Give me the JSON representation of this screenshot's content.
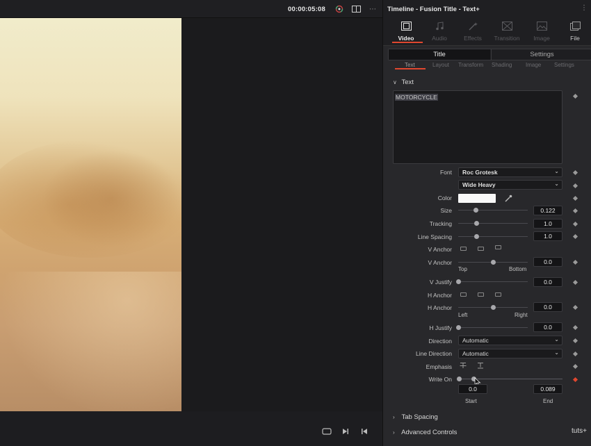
{
  "viewer": {
    "timecode": "00:00:05:08"
  },
  "inspector": {
    "title": "Timeline - Fusion Title - Text+",
    "tabs": [
      {
        "label": "Video",
        "icon": "film-icon",
        "state": "active"
      },
      {
        "label": "Audio",
        "icon": "music-note-icon",
        "state": "dim"
      },
      {
        "label": "Effects",
        "icon": "magic-wand-icon",
        "state": "dim"
      },
      {
        "label": "Transition",
        "icon": "transition-icon",
        "state": "dim"
      },
      {
        "label": "Image",
        "icon": "image-icon",
        "state": "dim"
      },
      {
        "label": "File",
        "icon": "file-icon",
        "state": "normal"
      }
    ],
    "segments": {
      "title": "Title",
      "settings": "Settings"
    },
    "subtabs": [
      "Text",
      "Layout",
      "Transform",
      "Shading",
      "Image",
      "Settings"
    ],
    "text_section": {
      "header": "Text",
      "content": "MOTORCYCLE",
      "font_label": "Font",
      "font_value": "Roc Grotesk",
      "style_value": "Wide Heavy",
      "color_label": "Color",
      "color_value": "#f8f8f8",
      "size_label": "Size",
      "size_value": "0.122",
      "size_level": 0.25,
      "tracking_label": "Tracking",
      "tracking_value": "1.0",
      "tracking_level": 0.26,
      "line_spacing_label": "Line Spacing",
      "line_spacing_value": "1.0",
      "line_spacing_level": 0.26,
      "v_anchor_label": "V Anchor",
      "v_anchor_value": "0.0",
      "v_anchor_level": 0.5,
      "v_anchor_left": "Top",
      "v_anchor_right": "Bottom",
      "v_justify_label": "V Justify",
      "v_justify_value": "0.0",
      "v_justify_level": 0.0,
      "h_anchor_label": "H Anchor",
      "h_anchor_value": "0.0",
      "h_anchor_level": 0.5,
      "h_anchor_left": "Left",
      "h_anchor_right": "Right",
      "h_justify_label": "H Justify",
      "h_justify_value": "0.0",
      "h_justify_level": 0.0,
      "direction_label": "Direction",
      "direction_value": "Automatic",
      "line_direction_label": "Line Direction",
      "line_direction_value": "Automatic",
      "emphasis_label": "Emphasis",
      "write_on_label": "Write On",
      "write_on_start_value": "0.0",
      "write_on_end_value": "0.089",
      "write_on_start_label": "Start",
      "write_on_end_label": "End"
    },
    "collapsed_sections": [
      "Tab Spacing",
      "Advanced Controls"
    ]
  },
  "watermark": "tuts+"
}
